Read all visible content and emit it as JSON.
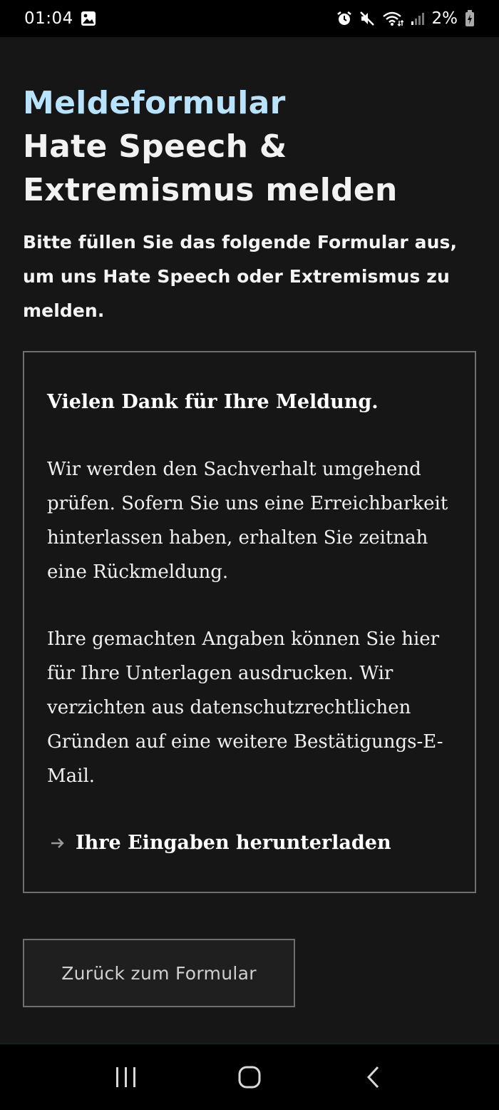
{
  "status_bar": {
    "time": "01:04",
    "battery": "2%",
    "icons": [
      "image-icon",
      "alarm-icon",
      "mute-icon",
      "wifi-icon",
      "signal-icon",
      "battery-charging-icon"
    ]
  },
  "page": {
    "kicker": "Meldeformular",
    "title_line1": "Hate Speech &",
    "title_line2": "Extremismus melden",
    "intro": "Bitte füllen Sie das folgende Formular aus, um uns Hate Speech oder Extremismus zu melden."
  },
  "message": {
    "heading": "Vielen Dank für Ihre Meldung.",
    "para1": "Wir werden den Sachverhalt umgehend prüfen. Sofern Sie uns eine Erreichbarkeit hinterlassen haben, erhalten Sie zeitnah eine Rückmeldung.",
    "para2": "Ihre gemachten Angaben können Sie hier für Ihre Unterlagen ausdrucken. Wir verzichten aus datenschutzrechtlichen Gründen auf eine weitere Bestätigungs-E-Mail.",
    "download_label": "Ihre Eingaben herunterladen"
  },
  "actions": {
    "back_label": "Zurück zum Formular"
  },
  "nav": {
    "items": [
      "recent-apps-icon",
      "home-icon",
      "back-icon"
    ]
  },
  "colors": {
    "accent": "#b9e3fb",
    "background": "#161616",
    "border": "#6f6f6f"
  }
}
